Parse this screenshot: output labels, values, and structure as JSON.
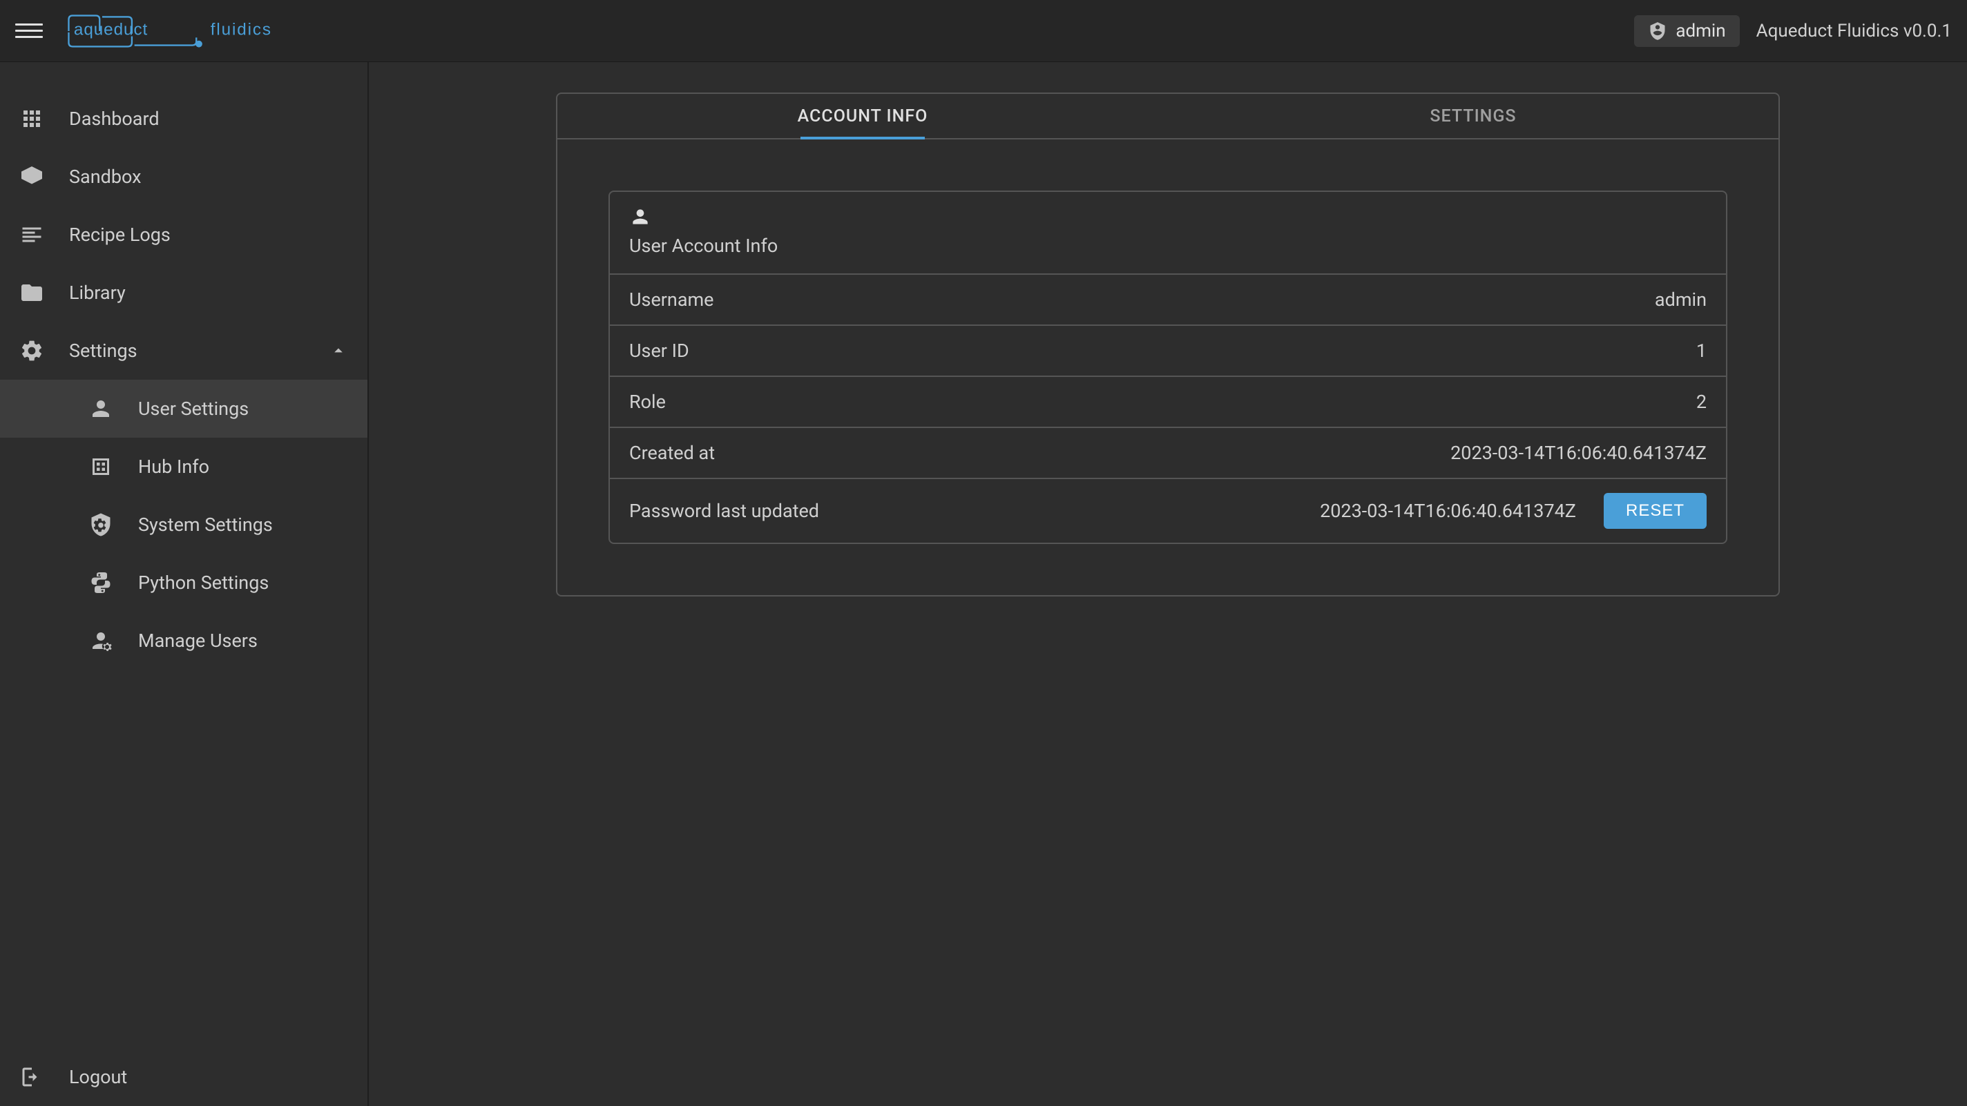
{
  "header": {
    "brand_name": "aqueduct fluidics",
    "user_label": "admin",
    "version": "Aqueduct Fluidics v0.0.1"
  },
  "sidebar": {
    "items": [
      {
        "label": "Dashboard",
        "icon": "apps-icon"
      },
      {
        "label": "Sandbox",
        "icon": "sandbox-icon"
      },
      {
        "label": "Recipe Logs",
        "icon": "logs-icon"
      },
      {
        "label": "Library",
        "icon": "folder-icon"
      },
      {
        "label": "Settings",
        "icon": "gear-icon",
        "expanded": true
      }
    ],
    "sub_items": [
      {
        "label": "User Settings",
        "icon": "user-icon",
        "active": true
      },
      {
        "label": "Hub Info",
        "icon": "hub-icon"
      },
      {
        "label": "System Settings",
        "icon": "system-gear-icon"
      },
      {
        "label": "Python Settings",
        "icon": "python-icon"
      },
      {
        "label": "Manage Users",
        "icon": "manage-users-icon"
      }
    ],
    "logout_label": "Logout"
  },
  "tabs": {
    "account_info": "ACCOUNT INFO",
    "settings": "SETTINGS"
  },
  "account_card": {
    "header_title": "User Account Info",
    "rows": [
      {
        "label": "Username",
        "value": "admin"
      },
      {
        "label": "User ID",
        "value": "1"
      },
      {
        "label": "Role",
        "value": "2"
      },
      {
        "label": "Created at",
        "value": "2023-03-14T16:06:40.641374Z"
      },
      {
        "label": "Password last updated",
        "value": "2023-03-14T16:06:40.641374Z",
        "action": "RESET"
      }
    ]
  }
}
